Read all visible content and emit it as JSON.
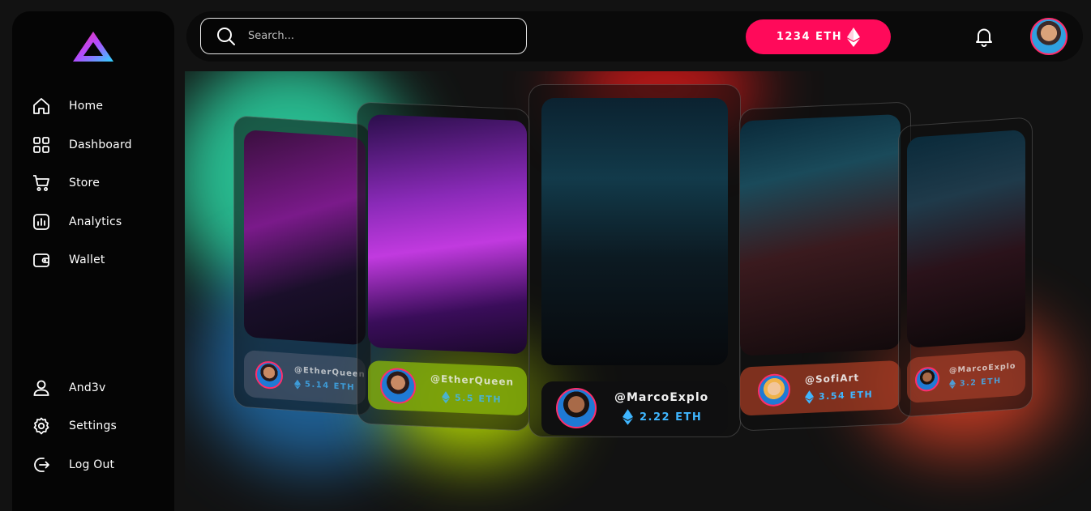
{
  "sidebar": {
    "brand": "logo-icon",
    "items": [
      {
        "label": "Home",
        "icon": "home-icon"
      },
      {
        "label": "Dashboard",
        "icon": "dashboard-icon"
      },
      {
        "label": "Store",
        "icon": "cart-icon"
      },
      {
        "label": "Analytics",
        "icon": "analytics-icon"
      },
      {
        "label": "Wallet",
        "icon": "wallet-icon"
      }
    ],
    "bottom": [
      {
        "label": "And3v",
        "icon": "user-icon"
      },
      {
        "label": "Settings",
        "icon": "gear-icon"
      },
      {
        "label": "Log Out",
        "icon": "logout-icon"
      }
    ]
  },
  "header": {
    "search_placeholder": "Search...",
    "balance": "1234 ETH"
  },
  "cards": [
    {
      "handle": "@EtherQueen",
      "price": "5.14 ETH"
    },
    {
      "handle": "@EtherQueen",
      "price": "5.5 ETH"
    },
    {
      "handle": "@MarcoExplo",
      "price": "2.22 ETH"
    },
    {
      "handle": "@SofiArt",
      "price": "3.54 ETH"
    },
    {
      "handle": "@MarcoExplo",
      "price": "3.2 ETH"
    }
  ],
  "colors": {
    "accent": "#ff0a5a",
    "eth_blue": "#3fb6ff",
    "glow_green": "#2ee6b0",
    "glow_lime": "#c8f000",
    "glow_red": "#ff1a1a",
    "glow_orange": "#ff5a2a"
  }
}
